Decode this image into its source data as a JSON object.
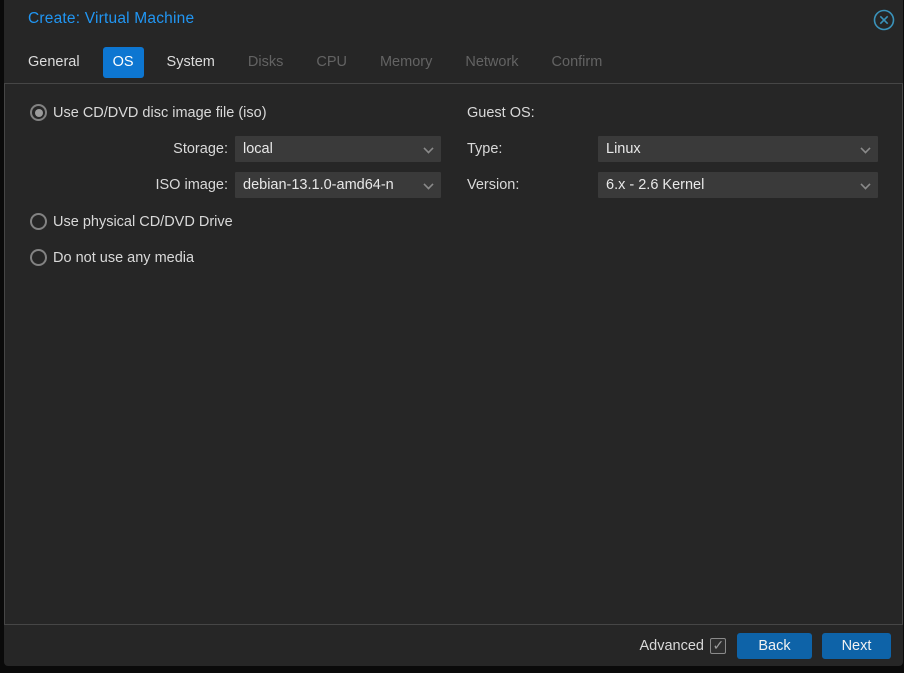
{
  "dialog": {
    "title": "Create: Virtual Machine",
    "close_icon": "circle-x-icon"
  },
  "tabs": [
    {
      "label": "General",
      "state": "enabled"
    },
    {
      "label": "OS",
      "state": "active"
    },
    {
      "label": "System",
      "state": "enabled"
    },
    {
      "label": "Disks",
      "state": "disabled"
    },
    {
      "label": "CPU",
      "state": "disabled"
    },
    {
      "label": "Memory",
      "state": "disabled"
    },
    {
      "label": "Network",
      "state": "disabled"
    },
    {
      "label": "Confirm",
      "state": "disabled"
    }
  ],
  "form": {
    "left": {
      "radio_iso": {
        "label": "Use CD/DVD disc image file (iso)",
        "selected": true
      },
      "storage": {
        "label": "Storage:",
        "value": "local"
      },
      "iso_image": {
        "label": "ISO image:",
        "value": "debian-13.1.0-amd64-n"
      },
      "radio_physical": {
        "label": "Use physical CD/DVD Drive",
        "selected": false
      },
      "radio_no_media": {
        "label": "Do not use any media",
        "selected": false
      }
    },
    "right": {
      "section_label": "Guest OS:",
      "type": {
        "label": "Type:",
        "value": "Linux"
      },
      "version": {
        "label": "Version:",
        "value": "6.x - 2.6 Kernel"
      }
    }
  },
  "footer": {
    "advanced_label": "Advanced",
    "advanced_checked": true,
    "back_label": "Back",
    "next_label": "Next"
  },
  "colors": {
    "dialog_bg": "#262626",
    "panel_border": "#464646",
    "title_blue": "#2196f3",
    "active_tab_blue": "#0d76d1",
    "button_blue": "#0e63a8",
    "field_bg": "#3a3a3a",
    "label_gray": "#d9d9d9",
    "disabled_tab_gray": "#636363",
    "close_icon_blue": "#3a93bb"
  }
}
